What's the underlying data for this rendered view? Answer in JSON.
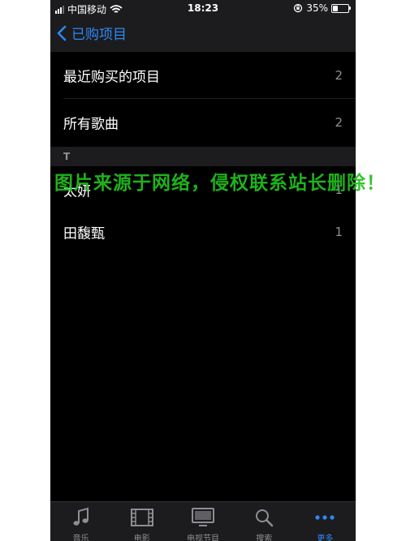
{
  "status_bar": {
    "carrier": "中国移动",
    "time": "18:23",
    "battery_percent": "35%",
    "battery_level": 0.35,
    "icons": [
      "signal-icon",
      "wifi-icon",
      "orientation-lock-icon",
      "battery-icon"
    ]
  },
  "nav": {
    "back_label": "已购项目",
    "back_icon": "chevron-left-icon",
    "accent_color": "#2f88f5"
  },
  "top_rows": [
    {
      "label": "最近购买的项目",
      "count": "2"
    },
    {
      "label": "所有歌曲",
      "count": "2"
    }
  ],
  "section": {
    "header": "T",
    "rows": [
      {
        "label": "太妍",
        "count": "1"
      },
      {
        "label": "田馥甄",
        "count": "1"
      }
    ]
  },
  "watermark": "图片来源于网络，侵权联系站长删除！",
  "tab_bar": {
    "tabs": [
      {
        "label": "音乐",
        "icon": "music-note-icon"
      },
      {
        "label": "电影",
        "icon": "film-icon"
      },
      {
        "label": "电视节目",
        "icon": "tv-icon"
      },
      {
        "label": "搜索",
        "icon": "search-icon"
      },
      {
        "label": "更多",
        "icon": "more-icon"
      }
    ],
    "active_tab": "更多"
  }
}
